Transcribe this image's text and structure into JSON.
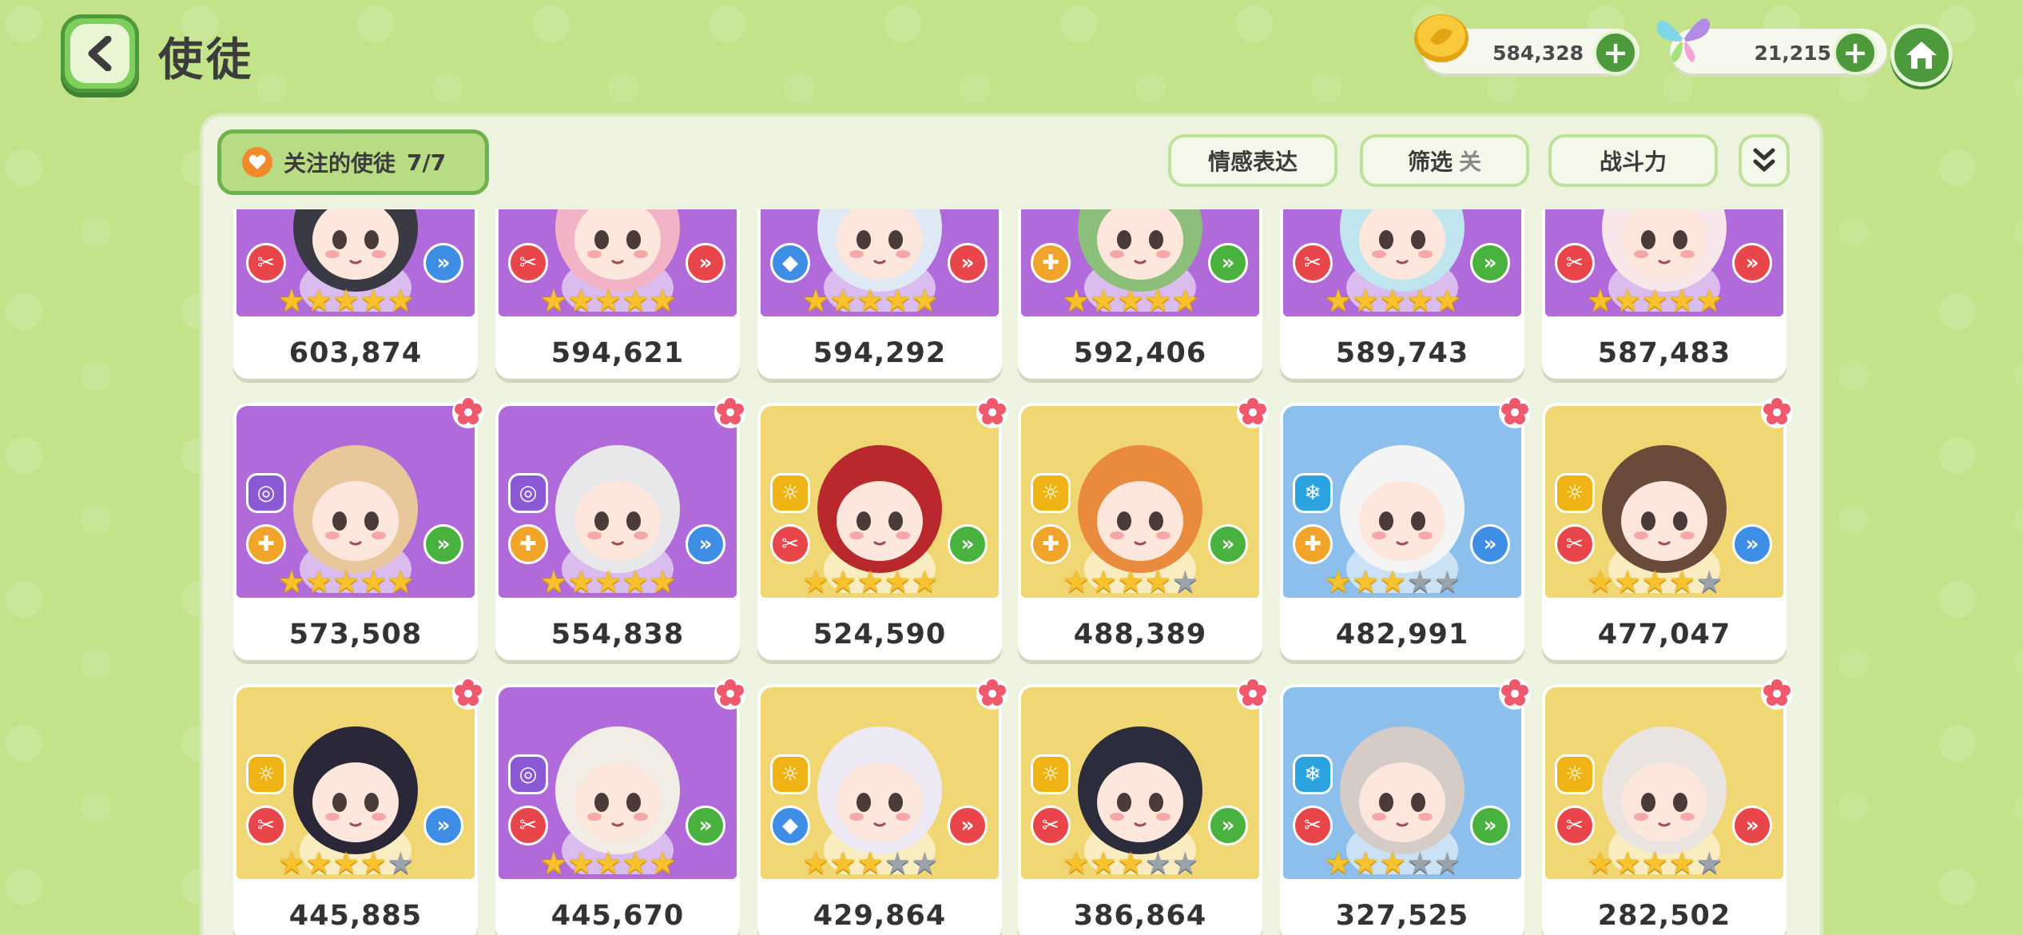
{
  "header": {
    "title": "使徒",
    "gold_amount": "584,328",
    "gem_amount": "21,215",
    "plus_label": "+"
  },
  "toolbar": {
    "follow_label": "关注的使徒",
    "follow_count": "7/7",
    "emotion_label": "情感表达",
    "filter_label": "筛选",
    "filter_state": "关",
    "sort_label": "战斗力"
  },
  "colors": {
    "background": "#c3e38a",
    "accent_green": "#4c9a3b",
    "purple_card": "#b06ad9",
    "yellow_card": "#f1d774",
    "blue_card": "#8cbfec",
    "fav_orange": "#f5892a"
  },
  "cards": [
    {
      "power": "603,874",
      "bg": "purple",
      "stars": 5,
      "role": "scissors",
      "arrow": "blue",
      "fav": false,
      "flower": false
    },
    {
      "power": "594,621",
      "bg": "purple",
      "stars": 5,
      "role": "scissors",
      "arrow": "red",
      "fav": false,
      "flower": false
    },
    {
      "power": "594,292",
      "bg": "purple",
      "stars": 5,
      "role": "shield",
      "arrow": "red",
      "fav": false,
      "flower": false
    },
    {
      "power": "592,406",
      "bg": "purple",
      "stars": 5,
      "role": "cross",
      "arrow": "green",
      "fav": false,
      "flower": false
    },
    {
      "power": "589,743",
      "bg": "purple",
      "stars": 5,
      "role": "scissors",
      "arrow": "green",
      "fav": false,
      "flower": false
    },
    {
      "power": "587,483",
      "bg": "purple",
      "stars": 5,
      "role": "scissors",
      "arrow": "red",
      "fav": false,
      "flower": false
    },
    {
      "power": "573,508",
      "bg": "purple",
      "stars": 5,
      "role": "cross",
      "arrow": "green",
      "element": "swirl",
      "fav": true,
      "flower": true
    },
    {
      "power": "554,838",
      "bg": "purple",
      "stars": 5,
      "role": "cross",
      "arrow": "blue",
      "element": "swirl",
      "fav": true,
      "flower": true
    },
    {
      "power": "524,590",
      "bg": "yellow",
      "stars": 5,
      "role": "scissors",
      "arrow": "green",
      "element": "sun",
      "fav": false,
      "flower": true
    },
    {
      "power": "488,389",
      "bg": "yellow",
      "stars": 4,
      "role": "cross",
      "arrow": "green",
      "element": "sun",
      "fav": false,
      "flower": true
    },
    {
      "power": "482,991",
      "bg": "blue",
      "stars": 3,
      "role": "cross",
      "arrow": "blue",
      "element": "snow",
      "fav": true,
      "flower": true
    },
    {
      "power": "477,047",
      "bg": "yellow",
      "stars": 4,
      "role": "scissors",
      "arrow": "blue",
      "element": "sun",
      "fav": false,
      "flower": true
    },
    {
      "power": "445,885",
      "bg": "yellow",
      "stars": 4,
      "role": "scissors",
      "arrow": "blue",
      "element": "sun",
      "fav": false,
      "flower": true
    },
    {
      "power": "445,670",
      "bg": "purple",
      "stars": 5,
      "role": "scissors",
      "arrow": "green",
      "element": "swirl",
      "fav": false,
      "flower": true
    },
    {
      "power": "429,864",
      "bg": "yellow",
      "stars": 3,
      "role": "shield",
      "arrow": "red",
      "element": "sun",
      "fav": false,
      "flower": true
    },
    {
      "power": "386,864",
      "bg": "yellow",
      "stars": 3,
      "role": "scissors",
      "arrow": "green",
      "element": "sun",
      "fav": false,
      "flower": true
    },
    {
      "power": "327,525",
      "bg": "blue",
      "stars": 3,
      "role": "scissors",
      "arrow": "green",
      "element": "snow",
      "fav": false,
      "flower": true
    },
    {
      "power": "282,502",
      "bg": "yellow",
      "stars": 4,
      "role": "scissors",
      "arrow": "red",
      "element": "sun",
      "fav": false,
      "flower": true
    }
  ]
}
